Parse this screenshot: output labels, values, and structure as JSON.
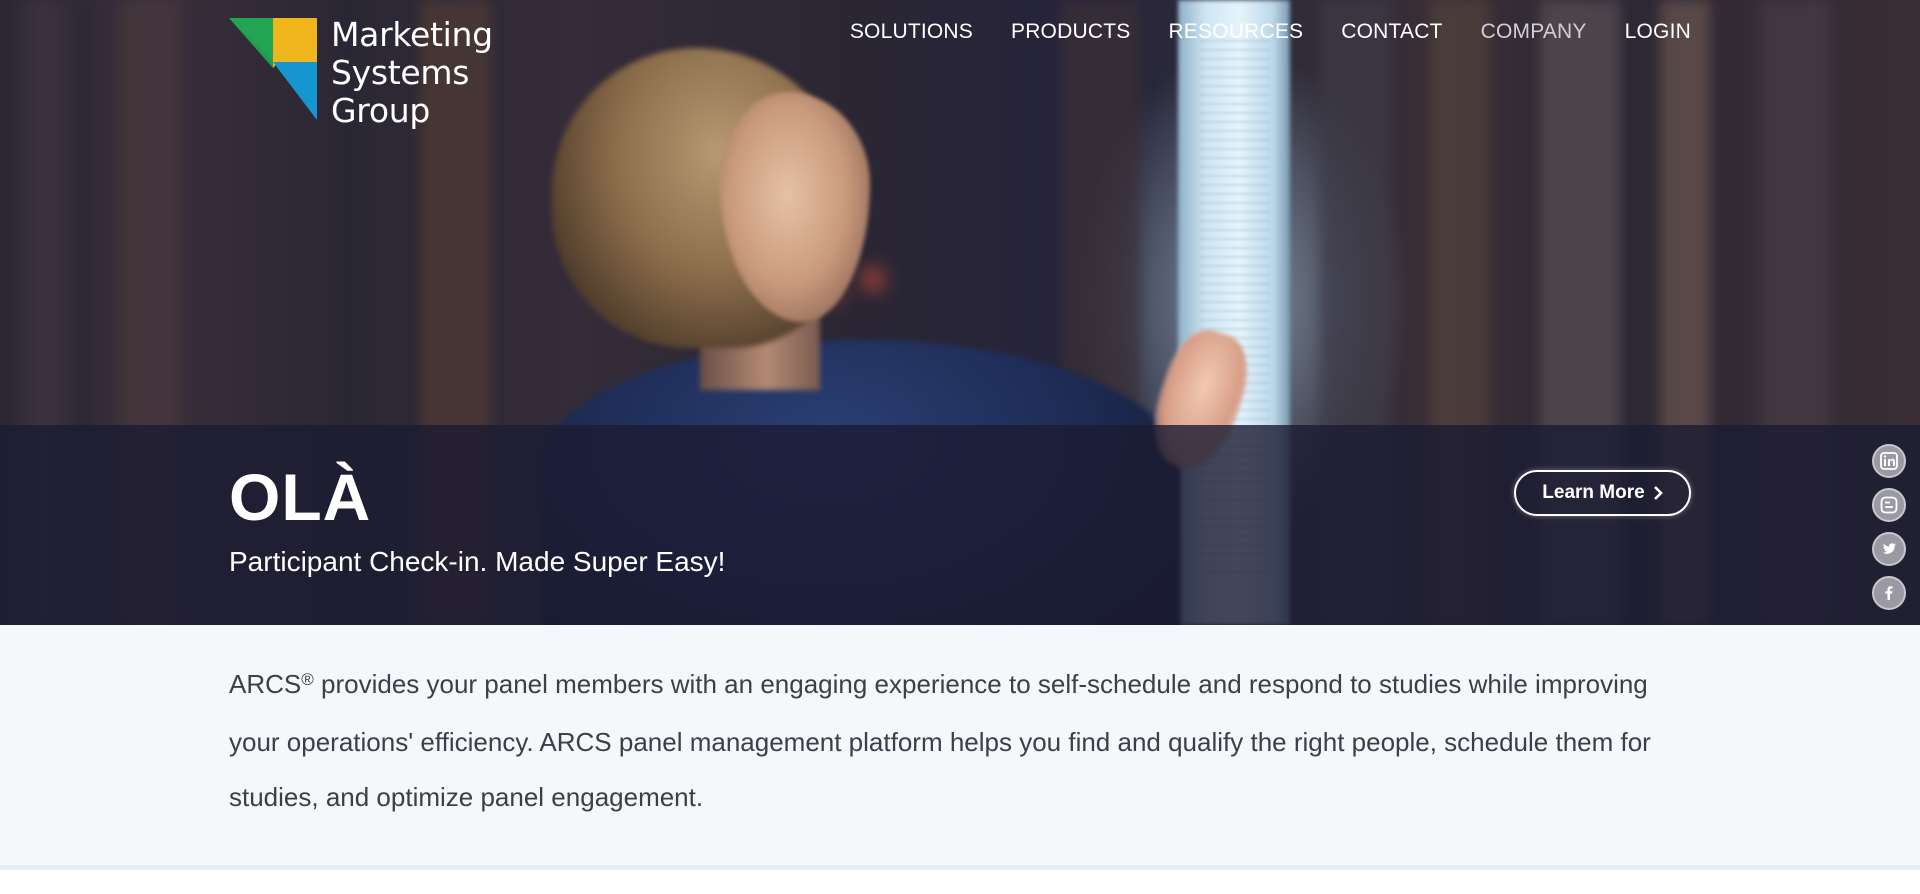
{
  "brand": {
    "logo_lines": [
      "Marketing",
      "Systems",
      "Group"
    ],
    "colors": {
      "green": "#1e9b4f",
      "yellow": "#f0b41c",
      "blue": "#1696cf"
    }
  },
  "nav": {
    "items": [
      {
        "label": "SOLUTIONS"
      },
      {
        "label": "PRODUCTS"
      },
      {
        "label": "RESOURCES"
      },
      {
        "label": "CONTACT"
      },
      {
        "label": "COMPANY"
      },
      {
        "label": "LOGIN"
      }
    ]
  },
  "hero": {
    "title": "OLÀ",
    "subtitle": "Participant Check-in. Made Super Easy!",
    "cta_label": "Learn More",
    "cta_icon": "chevron-right-icon"
  },
  "social": {
    "icons": [
      "linkedin-icon",
      "blogger-icon",
      "twitter-icon",
      "facebook-icon"
    ]
  },
  "intro": {
    "brand": "ARCS",
    "registered": "®",
    "text": " provides your panel members with an engaging experience to self-schedule and respond to studies while improving your operations' efficiency. ARCS panel management platform helps you find and qualify the right people, schedule them for studies, and optimize panel engagement."
  }
}
